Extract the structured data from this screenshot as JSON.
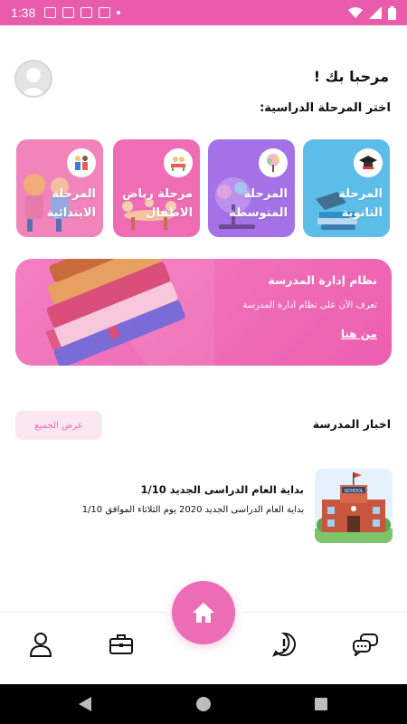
{
  "status_bar": {
    "time": "1:38",
    "icons": [
      "gmail-icon",
      "gmail-icon",
      "translate-icon",
      "download-icon",
      "dot-icon",
      "wifi-icon",
      "signal-icon",
      "battery-icon"
    ]
  },
  "header": {
    "welcome": "مرحبا بك !",
    "choose_stage": "اختر المرحلة الدراسية:"
  },
  "stages": [
    {
      "label": "المرحلة الثانوية",
      "color": "#5dbde9",
      "icon": "graduation-cap-icon"
    },
    {
      "label": "المرحلة المتوسطة",
      "color": "#a472e6",
      "icon": "tree-icon"
    },
    {
      "label": "مرحلة رياض الاطفال",
      "color": "#ef6db5",
      "icon": "kindergarten-icon"
    },
    {
      "label": "المرحلة الابتدائية",
      "color": "#f184ba",
      "icon": "kids-icon"
    }
  ],
  "banner": {
    "title": "نظام إدارة المدرسة",
    "subtitle": "تعرف الآن على نظام ادارة المدرسة",
    "link": "من هنا"
  },
  "news": {
    "header": "اخبار المدرسة",
    "view_all": "عرض الجميع",
    "items": [
      {
        "title": "بداية العام الدراسى الجديد 1/10",
        "body": "بداية العام الدراسى الجديد  2020 يوم الثلاثاء الموافق 1/10",
        "thumb": "school-building-icon"
      }
    ]
  },
  "bottom_nav": {
    "items": [
      "profile-icon",
      "briefcase-icon",
      "home-icon",
      "alert-icon",
      "chat-icon"
    ],
    "accent": "#ec6cb5"
  },
  "colors": {
    "status_bar": "#e85cab",
    "accent": "#ec6cb5"
  }
}
